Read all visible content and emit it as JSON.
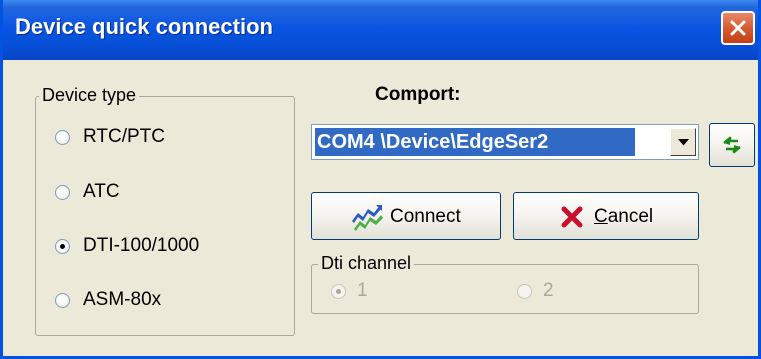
{
  "window": {
    "title": "Device quick connection"
  },
  "device_type": {
    "legend": "Device type",
    "options": [
      {
        "label": "RTC/PTC",
        "selected": false
      },
      {
        "label": "ATC",
        "selected": false
      },
      {
        "label": "DTI-100/1000",
        "selected": true
      },
      {
        "label": "ASM-80x",
        "selected": false
      }
    ]
  },
  "comport": {
    "label": "Comport:",
    "selected_value": "COM4 \\Device\\EdgeSer2"
  },
  "buttons": {
    "connect_label": "Connect",
    "cancel_first_letter": "C",
    "cancel_rest": "ancel"
  },
  "dti_channel": {
    "legend": "Dti channel",
    "options": [
      {
        "label": "1",
        "selected": true,
        "disabled": true
      },
      {
        "label": "2",
        "selected": false,
        "disabled": true
      }
    ]
  },
  "icons": {
    "close": "close-icon",
    "refresh": "refresh-arrows-icon",
    "connect": "connect-icon",
    "cancel": "red-x-icon",
    "dropdown": "chevron-down-icon"
  },
  "colors": {
    "titlebar": "#0a55e3",
    "close_button": "#d95a32",
    "selection": "#316ac5",
    "dialog_bg": "#ece9d8"
  }
}
